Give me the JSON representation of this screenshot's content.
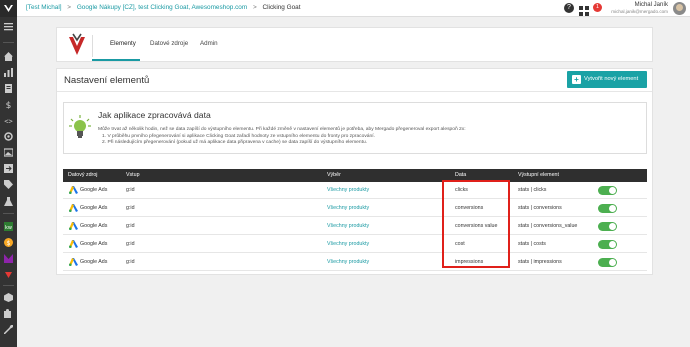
{
  "topbar": {
    "breadcrumb": {
      "item1": "[Test Michal]",
      "item2": "Google Nákupy [CZ], test Clicking Goat, Awesomeshop.com",
      "item3": "Clicking Goat",
      "separator": ">"
    },
    "help_label": "?",
    "notification_count": "1",
    "user_name": "Michal Janík",
    "user_email": "michal.janik@mergado.com"
  },
  "tabs": [
    {
      "label": "Elementy"
    },
    {
      "label": "Datové zdroje"
    },
    {
      "label": "Admin"
    }
  ],
  "main": {
    "title": "Nastavení elementů",
    "create_button": "Vytvořit nový element"
  },
  "info": {
    "title": "Jak aplikace zpracovává data",
    "text": "Může trvat až několik hodin, než se data zapíší do výstupního elementu. Při každé změně v nastavení elementů je potřeba, aby Mergado přegeneroval export alespoň 2x:",
    "steps": [
      "1. V průběhu prvního přegenerování si aplikace Clicking Goat zařadí hodnoty ze vstupního elementu do fronty pro zpracování.",
      "2. Při následujícím přegenerování (pokud už má aplikace data připravena v cache) se data zapíší do výstupního elementu."
    ]
  },
  "table": {
    "headers": [
      "Datový zdroj",
      "Vstup",
      "Výběr",
      "Data",
      "Výstupní element"
    ],
    "rows": [
      {
        "source": "Google Ads",
        "input": "g:id",
        "selection": "Všechny produkty",
        "data": "clicks",
        "output": "stats | clicks",
        "enabled": true
      },
      {
        "source": "Google Ads",
        "input": "g:id",
        "selection": "Všechny produkty",
        "data": "conversions",
        "output": "stats | conversions",
        "enabled": true
      },
      {
        "source": "Google Ads",
        "input": "g:id",
        "selection": "Všechny produkty",
        "data": "conversions value",
        "output": "stats | conversions_value",
        "enabled": true
      },
      {
        "source": "Google Ads",
        "input": "g:id",
        "selection": "Všechny produkty",
        "data": "cost",
        "output": "stats | costs",
        "enabled": true
      },
      {
        "source": "Google Ads",
        "input": "g:id",
        "selection": "Všechny produkty",
        "data": "impressions",
        "output": "stats | impressions",
        "enabled": true
      }
    ]
  },
  "colors": {
    "accent": "#1a9aa3",
    "toggle_on": "#4caf50",
    "highlight": "#e0201a",
    "sidebar": "#333333"
  }
}
